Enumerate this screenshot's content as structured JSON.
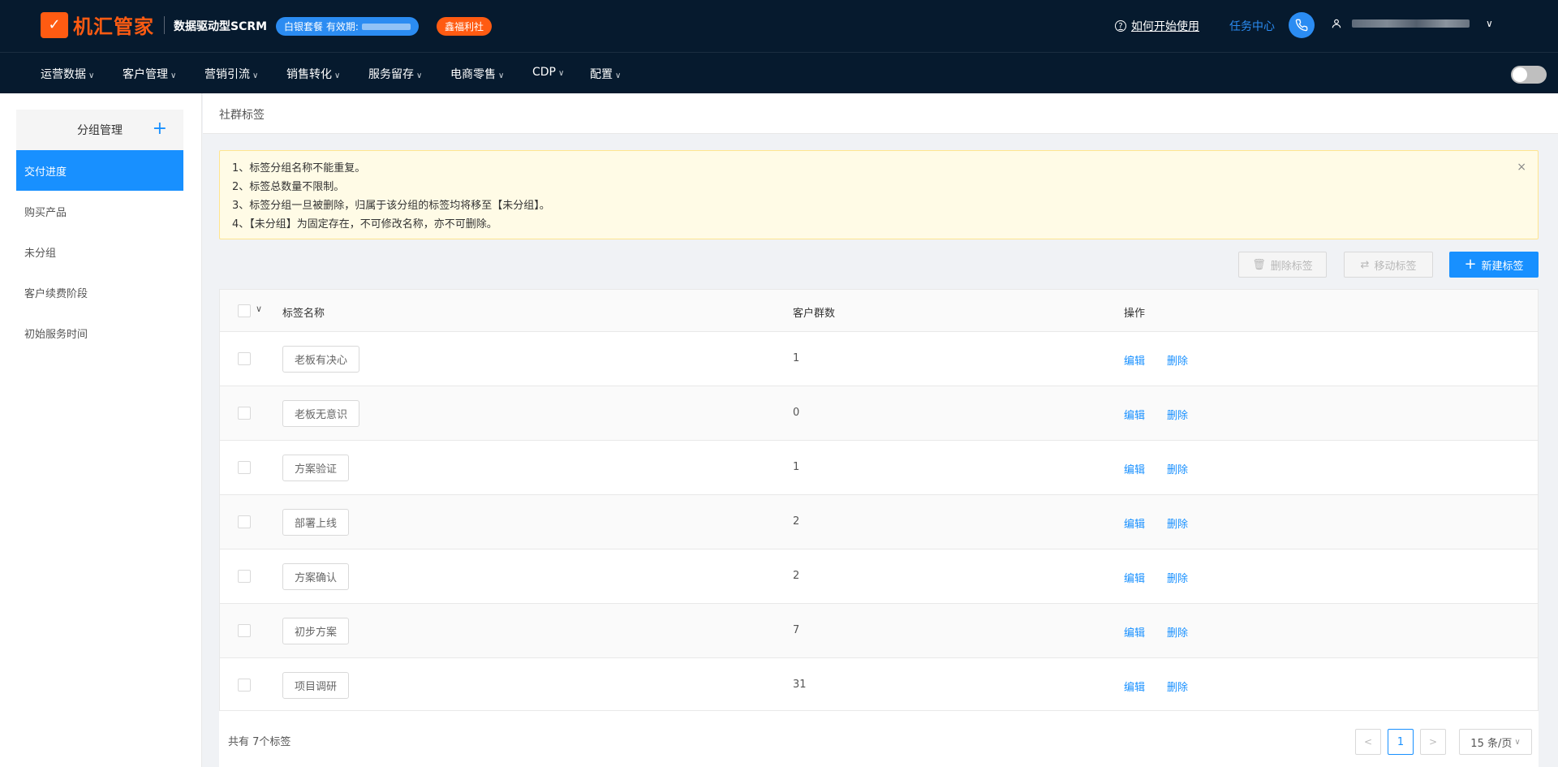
{
  "header": {
    "logo_mark": "✓",
    "logo_text": "机汇管家",
    "slogan": "数据驱动型SCRM",
    "plan_badge": "白银套餐 有效期:",
    "welfare_badge": "鑫福利社",
    "help_label": "如何开始使用",
    "help_icon": "?",
    "task_center": "任务中心",
    "user_chevron": "∨"
  },
  "nav": {
    "items": [
      "运营数据",
      "客户管理",
      "营销引流",
      "销售转化",
      "服务留存",
      "电商零售",
      "CDP",
      "配置"
    ],
    "chevron": "∨"
  },
  "sidebar": {
    "title": "分组管理",
    "add_symbol": "+",
    "items": [
      "交付进度",
      "购买产品",
      "未分组",
      "客户续费阶段",
      "初始服务时间"
    ],
    "active_index": 0
  },
  "breadcrumb": "社群标签",
  "notice": {
    "lines": [
      "1、标签分组名称不能重复。",
      "2、标签总数量不限制。",
      "3、标签分组一旦被删除，归属于该分组的标签均将移至【未分组】。",
      "4、【未分组】为固定存在，不可修改名称，亦不可删除。"
    ],
    "close": "×"
  },
  "toolbar": {
    "delete_label": "删除标签",
    "move_label": "移动标签",
    "create_label": "新建标签",
    "delete_icon": "🗑",
    "move_icon": "⇄",
    "create_icon": "+"
  },
  "table": {
    "columns": [
      "标签名称",
      "客户群数",
      "操作"
    ],
    "select_chevron": "∨",
    "rows": [
      {
        "name": "老板有决心",
        "count": "1"
      },
      {
        "name": "老板无意识",
        "count": "0"
      },
      {
        "name": "方案验证",
        "count": "1"
      },
      {
        "name": "部署上线",
        "count": "2"
      },
      {
        "name": "方案确认",
        "count": "2"
      },
      {
        "name": "初步方案",
        "count": "7"
      },
      {
        "name": "项目调研",
        "count": "31"
      }
    ],
    "edit_label": "编辑",
    "delete_label": "删除"
  },
  "footer": {
    "total": "共有 7个标签",
    "current_page": "1",
    "prev": "<",
    "next": ">",
    "page_size": "15 条/页",
    "page_size_chevron": "∨"
  },
  "colors": {
    "header_bg": "#061a2e",
    "accent": "#1890ff",
    "brand": "#ff5b12",
    "notice_bg": "#fffbe6"
  }
}
